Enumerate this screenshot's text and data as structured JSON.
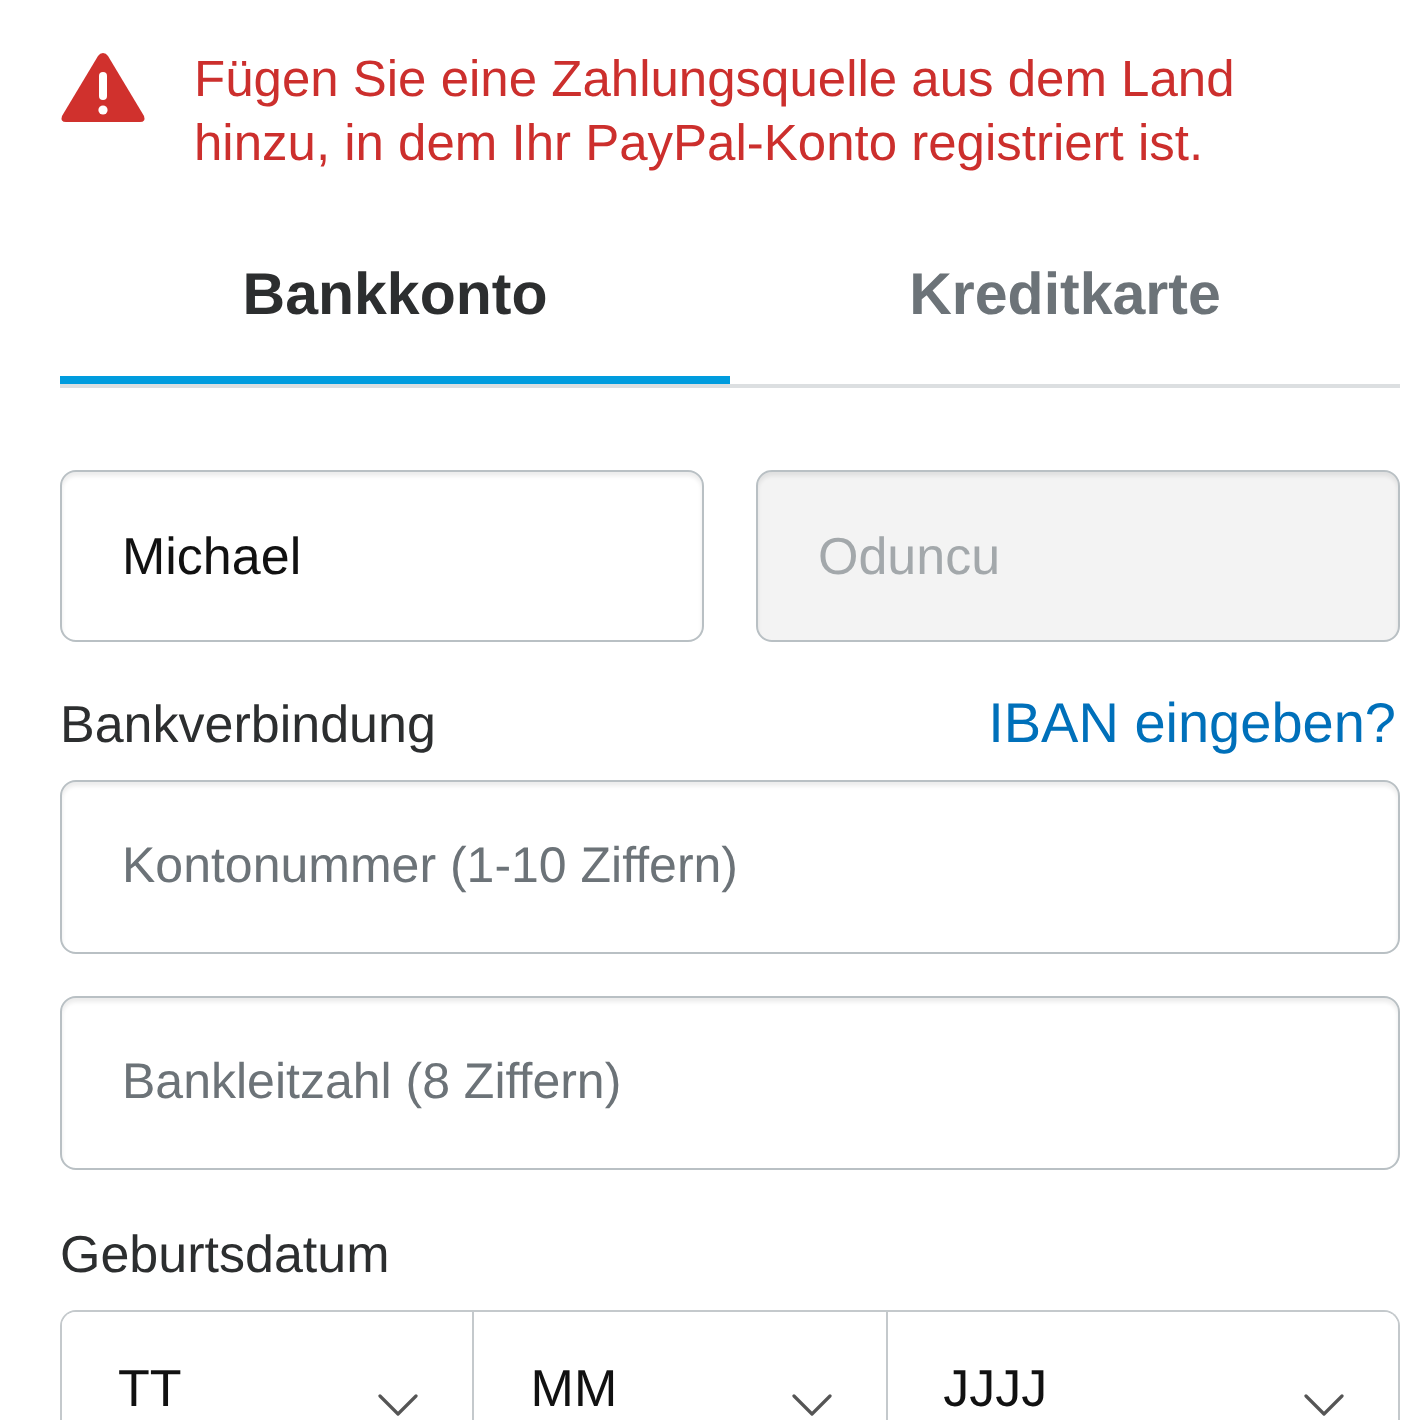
{
  "alert": {
    "message": "Fügen Sie eine Zahlungsquelle aus dem Land hinzu, in dem Ihr PayPal-Konto registriert ist."
  },
  "tabs": [
    {
      "label": "Bankkonto",
      "selected": true
    },
    {
      "label": "Kreditkarte",
      "selected": false
    }
  ],
  "name_fields": [
    {
      "value": "Michael",
      "disabled": false
    },
    {
      "value": "Oduncu",
      "disabled": true
    }
  ],
  "bank_section": {
    "label": "Bankverbindung",
    "link": "IBAN eingeben?",
    "fields": [
      {
        "placeholder": "Kontonummer (1-10 Ziffern)"
      },
      {
        "placeholder": "Bankleitzahl (8 Ziffern)"
      }
    ]
  },
  "birth_date": {
    "label": "Geburtsdatum",
    "selects": [
      {
        "placeholder": "TT"
      },
      {
        "placeholder": "MM"
      },
      {
        "placeholder": "JJJJ"
      }
    ]
  }
}
